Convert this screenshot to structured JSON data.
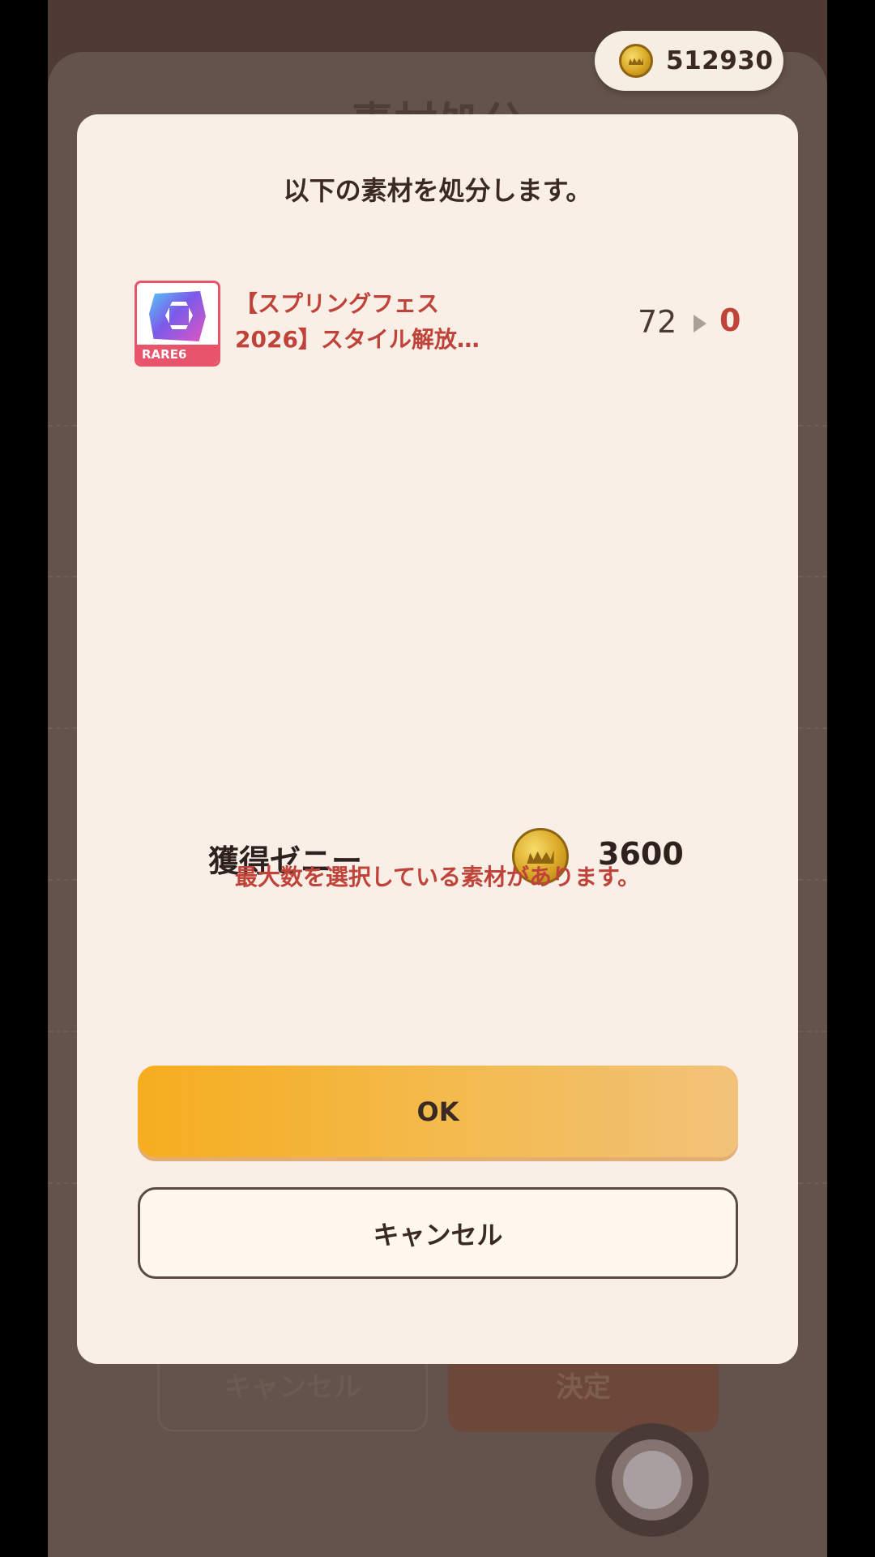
{
  "background": {
    "title": "素材処分",
    "cancel_label": "キャンセル",
    "confirm_label": "決定"
  },
  "balance": {
    "icon": "zeny-coin-icon",
    "value": "512930"
  },
  "dialog": {
    "title": "以下の素材を処分します。",
    "item": {
      "rarity": "RARE6",
      "name": "【スプリングフェス2026】スタイル解放…",
      "count_before": "72",
      "count_after": "0"
    },
    "zeny_label": "獲得ゼニー",
    "zeny_value": "3600",
    "warning": "最大数を選択している素材があります。",
    "ok_label": "OK",
    "cancel_label": "キャンセル"
  },
  "colors": {
    "accent": "#f6ad1f",
    "warning": "#c0433a",
    "rarity": "#e8556b"
  }
}
